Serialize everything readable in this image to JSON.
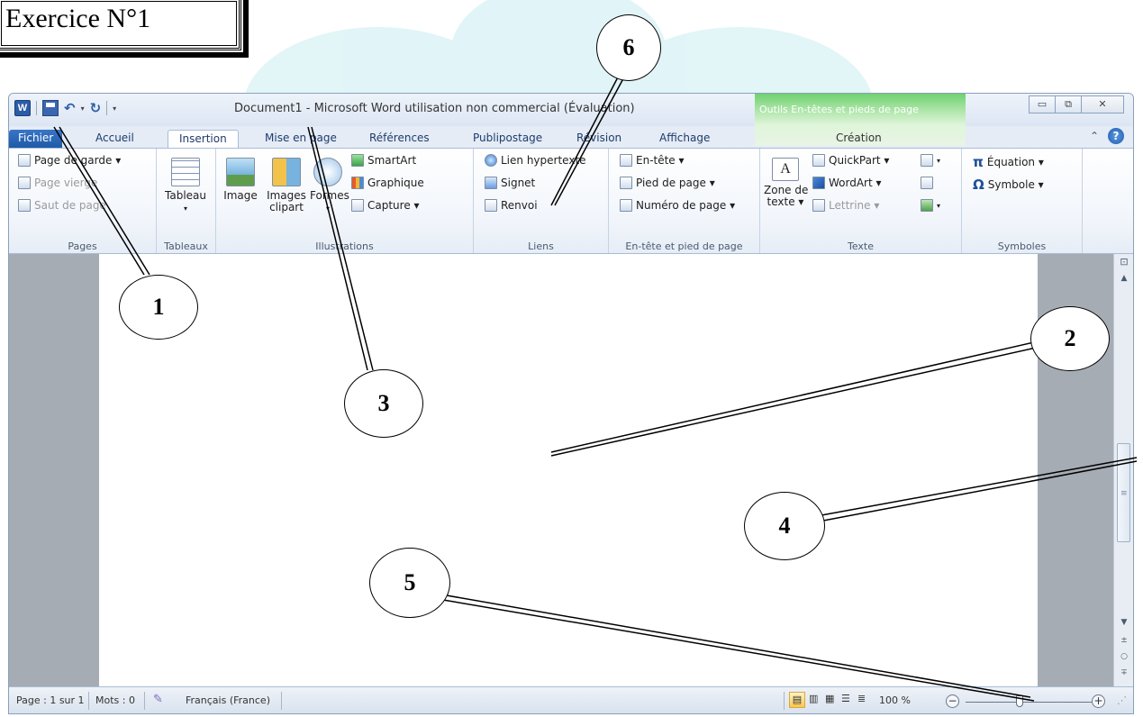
{
  "exercise_title": "Exercice N°1",
  "window": {
    "title": "Document1 - Microsoft Word utilisation non commercial (Évaluation)",
    "contextual_tab_title": "Outils En-têtes et pieds de page"
  },
  "tabs": [
    "Fichier",
    "Accueil",
    "Insertion",
    "Mise en page",
    "Références",
    "Publipostage",
    "Révision",
    "Affichage",
    "Création"
  ],
  "active_tab": "Insertion",
  "ribbon": {
    "pages": {
      "label": "Pages",
      "items": [
        "Page de garde ▾",
        "Page vierge",
        "Saut de page"
      ]
    },
    "tableaux": {
      "label": "Tableaux",
      "tableau": "Tableau"
    },
    "illustrations": {
      "label": "Illustrations",
      "image": "Image",
      "clipart_1": "Images",
      "clipart_2": "clipart",
      "formes": "Formes",
      "smartart": "SmartArt",
      "graphique": "Graphique",
      "capture": "Capture ▾"
    },
    "liens": {
      "label": "Liens",
      "items": [
        "Lien hypertexte",
        "Signet",
        "Renvoi"
      ]
    },
    "entete": {
      "label": "En-tête et pied de page",
      "items": [
        "En-tête ▾",
        "Pied de page ▾",
        "Numéro de page ▾"
      ]
    },
    "texte": {
      "label": "Texte",
      "zone_1": "Zone de",
      "zone_2": "texte ▾",
      "items": [
        "QuickPart ▾",
        "WordArt ▾",
        "Lettrine ▾"
      ]
    },
    "symboles": {
      "label": "Symboles",
      "equation": "Équation ▾",
      "symbole": "Symbole ▾"
    }
  },
  "statusbar": {
    "page": "Page : 1 sur 1",
    "words": "Mots : 0",
    "language": "Français (France)",
    "zoom": "100 %",
    "zoom_minus": "−",
    "zoom_plus": "+"
  },
  "callouts": [
    "1",
    "2",
    "3",
    "4",
    "5",
    "6"
  ],
  "colors": {
    "accent": "#2a5ca8",
    "file_tab": "#1f5aa8",
    "contextual": "#6fd16f"
  }
}
